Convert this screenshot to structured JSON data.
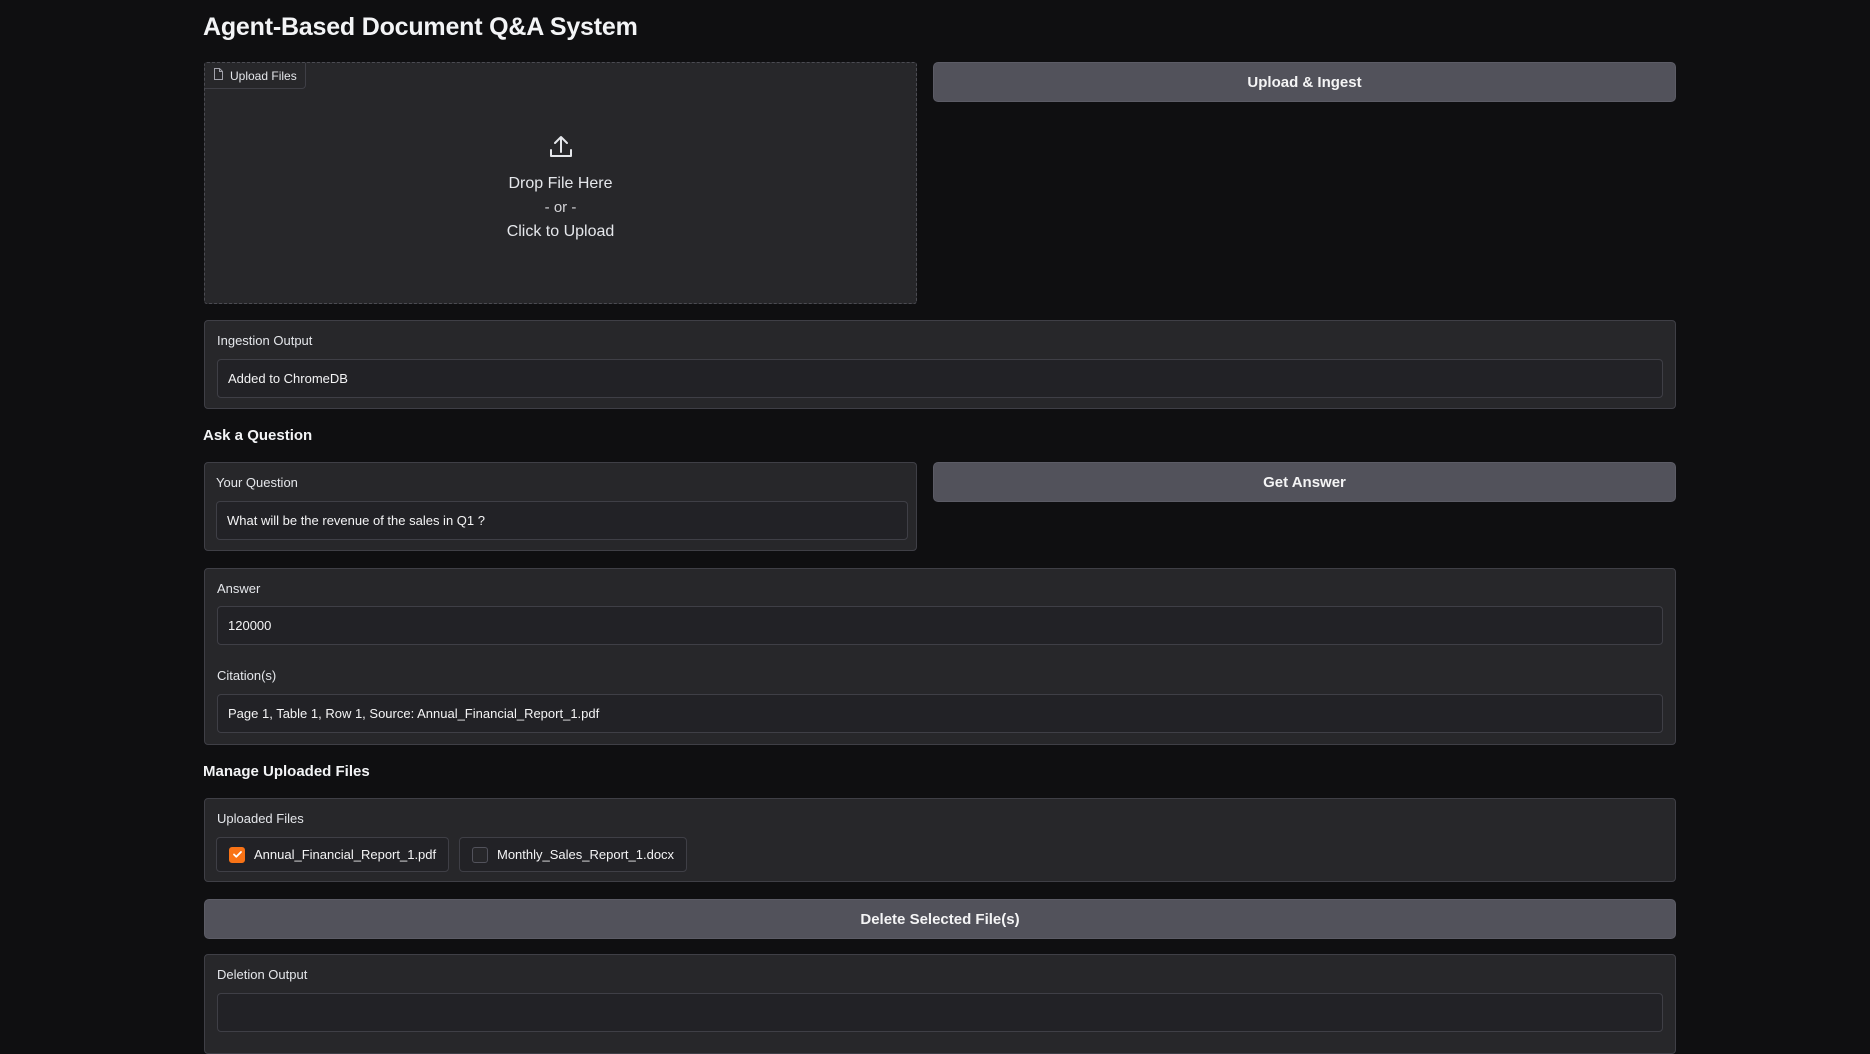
{
  "app": {
    "title": "Agent-Based Document Q&A System"
  },
  "upload": {
    "tag_label": "Upload Files",
    "drop_text": "Drop File Here",
    "or_text": "- or -",
    "click_text": "Click to Upload",
    "button_label": "Upload & Ingest"
  },
  "ingestion": {
    "label": "Ingestion Output",
    "value": "Added to ChromeDB"
  },
  "question_section": {
    "title": "Ask a Question",
    "question_label": "Your Question",
    "question_value": "What will be the revenue of the sales in Q1 ?",
    "button_label": "Get Answer"
  },
  "answer": {
    "label": "Answer",
    "value": "120000",
    "citation_label": "Citation(s)",
    "citation_value": "Page 1, Table 1, Row 1, Source: Annual_Financial_Report_1.pdf"
  },
  "manage": {
    "title": "Manage Uploaded Files",
    "files_label": "Uploaded Files",
    "files": [
      {
        "name": "Annual_Financial_Report_1.pdf",
        "checked": true
      },
      {
        "name": "Monthly_Sales_Report_1.docx",
        "checked": false
      }
    ],
    "delete_label": "Delete Selected File(s)",
    "deletion_label": "Deletion Output",
    "deletion_value": ""
  },
  "colors": {
    "background": "#0f0f11",
    "panel": "#27272a",
    "button": "#52525b",
    "accent": "#f97316"
  },
  "icons": [
    "file-icon",
    "upload-icon",
    "checkmark-icon"
  ]
}
